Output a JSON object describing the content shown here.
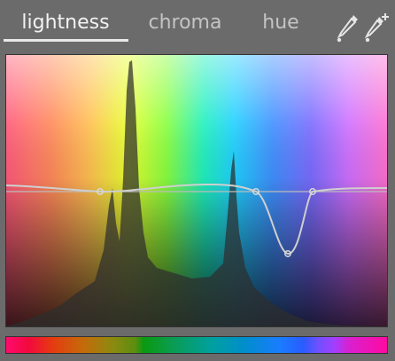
{
  "tabs": [
    {
      "label": "lightness",
      "active": true
    },
    {
      "label": "chroma",
      "active": false
    },
    {
      "label": "hue",
      "active": false
    }
  ],
  "toolbar": {
    "picker_icon": "eyedropper-icon",
    "picker_add_icon": "eyedropper-plus-icon"
  },
  "curve": {
    "node_count": 4,
    "color": "#c8c8c8"
  },
  "colors": {
    "background": "#6b6b6b",
    "active_tab": "#f2f2f2",
    "inactive_tab": "#c4c4c4",
    "histogram": "#2e2e2e"
  }
}
